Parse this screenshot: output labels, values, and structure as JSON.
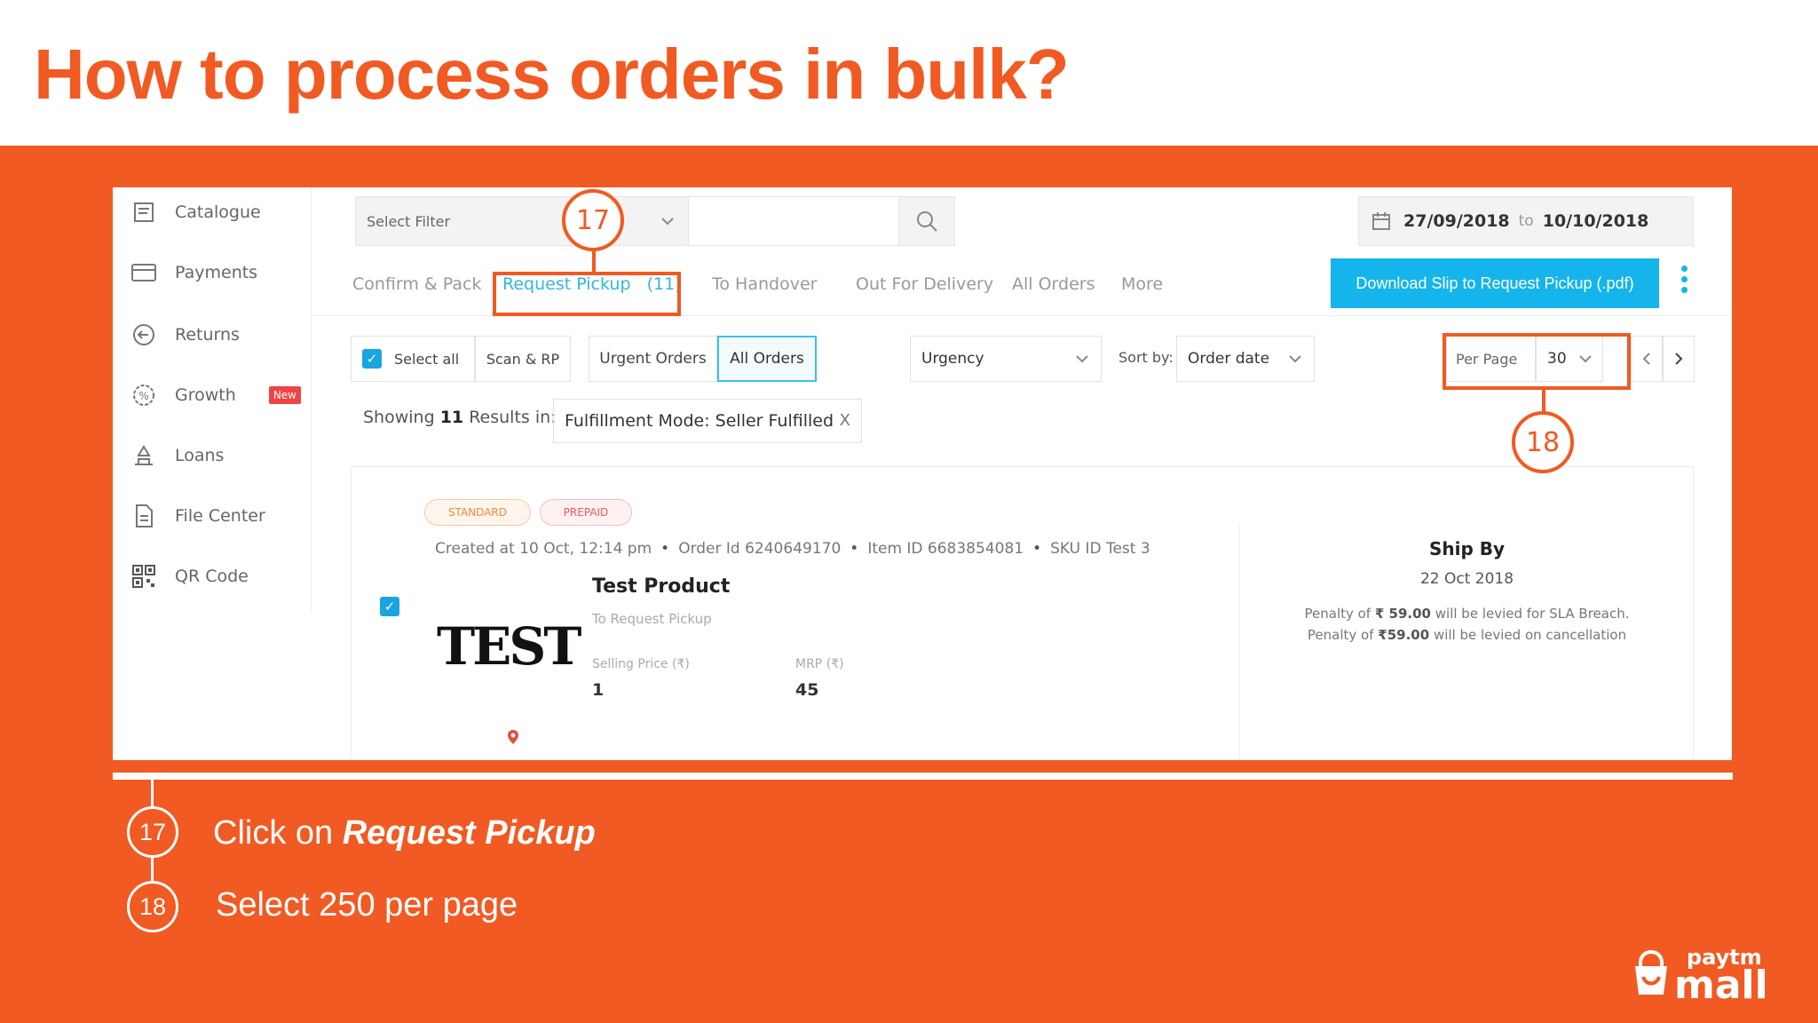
{
  "slide": {
    "title": "How to process orders in bulk?",
    "brand_color": "#f15a22"
  },
  "sidebar": {
    "items": [
      {
        "label": "Catalogue",
        "icon": "catalogue-icon"
      },
      {
        "label": "Payments",
        "icon": "payments-icon"
      },
      {
        "label": "Returns",
        "icon": "returns-icon"
      },
      {
        "label": "Growth",
        "icon": "growth-icon",
        "badge": "New"
      },
      {
        "label": "Loans",
        "icon": "loans-icon"
      },
      {
        "label": "File Center",
        "icon": "file-icon"
      },
      {
        "label": "QR Code",
        "icon": "qr-code-icon"
      }
    ]
  },
  "header": {
    "filter_placeholder": "Select Filter",
    "date_from": "27/09/2018",
    "date_sep": "to",
    "date_to": "10/10/2018",
    "download_label": "Download Slip to Request Pickup (.pdf)"
  },
  "tabs": [
    {
      "label": "Confirm & Pack"
    },
    {
      "label": "Request Pickup   (11)",
      "active": true
    },
    {
      "label": "To Handover"
    },
    {
      "label": "Out For Delivery"
    },
    {
      "label": "All Orders"
    },
    {
      "label": "More"
    }
  ],
  "toolbar": {
    "select_all": "Select all",
    "scan": "Scan & RP",
    "urgent_orders": "Urgent Orders",
    "all_orders": "All Orders",
    "urgency": "Urgency",
    "sort_by_label": "Sort by:",
    "sort_by_value": "Order date",
    "per_page_label": "Per Page",
    "per_page_value": "30"
  },
  "results": {
    "prefix": "Showing",
    "count": "11",
    "suffix": "Results in:",
    "chip": "Fulfillment Mode: Seller Fulfilled",
    "chip_close": "X"
  },
  "order": {
    "tag_standard": "STANDARD",
    "tag_prepaid": "PREPAID",
    "created": "Created at 10 Oct, 12:14 pm",
    "order_id": "Order Id 6240649170",
    "item_id": "Item ID 6683854081",
    "sku": "SKU ID Test 3",
    "image_text": "TEST",
    "name": "Test Product",
    "status": "To Request Pickup",
    "selling_price_label": "Selling Price (₹)",
    "selling_price": "1",
    "mrp_label": "MRP (₹)",
    "mrp": "45",
    "ship_by_label": "Ship By",
    "ship_by_date": "22 Oct 2018",
    "penalty_sla_pre": "Penalty of",
    "penalty_sla_amount": "₹ 59.00",
    "penalty_sla_post": "will be levied for SLA Breach.",
    "penalty_cancel_pre": "Penalty of",
    "penalty_cancel_amount": "₹59.00",
    "penalty_cancel_post": "will be levied on cancellation"
  },
  "callouts": {
    "step17": "17",
    "step18": "18"
  },
  "legend": [
    {
      "number": "17",
      "text_prefix": "Click on ",
      "text_bold": "Request Pickup"
    },
    {
      "number": "18",
      "text_prefix": "Select 250 per page",
      "text_bold": ""
    }
  ],
  "logo": {
    "top": "paytm",
    "bottom": "mall"
  }
}
